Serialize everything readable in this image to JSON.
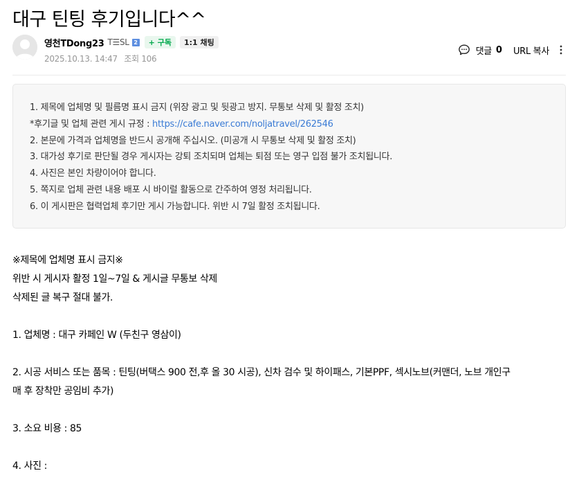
{
  "post": {
    "title": "대구 틴팅 후기입니다^^"
  },
  "author": {
    "nickname": "영천TDong23",
    "grade": "T☰SL",
    "grade_badge": "2",
    "subscribe_label": "+ 구독",
    "chat_label": "1:1 채팅",
    "date": "2025.10.13. 14:47",
    "views_label": "조회 106"
  },
  "tools": {
    "comment_label": "댓글",
    "comment_count": "0",
    "url_copy_label": "URL 복사",
    "icons": [
      "comment-icon",
      "more-icon"
    ]
  },
  "notice": {
    "line1": "1. 제목에 업체명 및 필름명 표시 금지 (위장 광고 및 뒷광고 방지. 무통보 삭제 및 활정 조치)",
    "line2_prefix": "*후기글 및 업체 관련 게시 규정 : ",
    "line2_link": "https://cafe.naver.com/noljatravel/262546",
    "line3": "2. 본문에 가격과 업체명을 반드시 공개해 주십시오. (미공개 시 무통보 삭제 및 활정 조치)",
    "line4": "3. 대가성 후기로 판단될 경우 게시자는 강퇴 조치되며 업체는 퇴점 또는 영구 입점 불가 조치됩니다.",
    "line5": "4. 사진은 본인 차량이어야 합니다.",
    "line6": "5. 쪽지로 업체 관련 내용 배포 시 바이럴 활동으로 간주하여 영정 처리됩니다.",
    "line7": "6. 이 게시판은 협력업체 후기만 게시 가능합니다. 위반 시 7일 활정 조치됩니다.",
    "link_color": "#3a7bd5"
  },
  "body": {
    "warn1": "※제목에 업체명 표시 금지※",
    "warn2": "위반 시 게시자 활정 1일~7일 & 게시글 무통보 삭제",
    "warn3": "삭제된 글 복구 절대 불가.",
    "item1": "1. 업체명 :  대구 카페인 W (두친구 영삼이)",
    "item2_a": "2. 시공 서비스 또는 품목 :  틴팅(버택스 900 전,후 올 30 시공), 신차 검수 및 하이패스, 기본PPF, 섹시노브(커맨더, 노브 개인구",
    "item2_b": "매 후 장착만 공임비 추가)",
    "item3": "3. 소요 비용 :  85",
    "item4": "4. 사진 :"
  },
  "colors": {
    "subscribe_text": "#03a94d",
    "subscribe_bg": "#e9f7ee",
    "meta_text": "#979797",
    "notice_bg": "#f7f7f7"
  }
}
